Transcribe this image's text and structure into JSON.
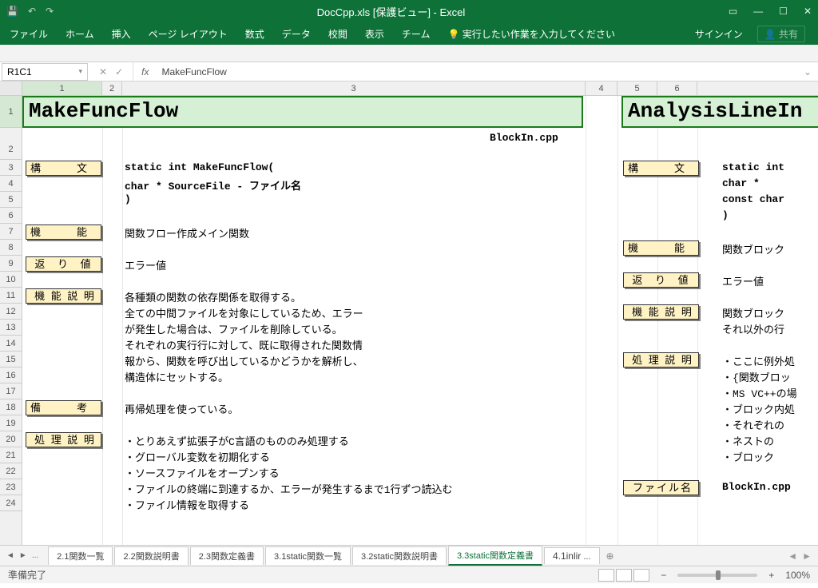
{
  "titlebar": {
    "title": "DocCpp.xls [保護ビュー] - Excel"
  },
  "ribbon": {
    "tabs": [
      "ファイル",
      "ホーム",
      "挿入",
      "ページ レイアウト",
      "数式",
      "データ",
      "校閲",
      "表示",
      "チーム"
    ],
    "tell_me": "実行したい作業を入力してください",
    "signin": "サインイン",
    "share": "共有"
  },
  "formula": {
    "name_box": "R1C1",
    "fx": "fx",
    "value": "MakeFuncFlow"
  },
  "columns": [
    "1",
    "2",
    "3",
    "4",
    "5",
    "6"
  ],
  "rows": [
    "1",
    "2",
    "3",
    "4",
    "5",
    "6",
    "7",
    "8",
    "9",
    "10",
    "11",
    "12",
    "13",
    "14",
    "15",
    "16",
    "17",
    "18",
    "19",
    "20",
    "21",
    "22",
    "23",
    "24"
  ],
  "block1": {
    "title": "MakeFuncFlow",
    "subtitle": "BlockIn.cpp",
    "labels": {
      "syntax": "構　文",
      "function": "機　能",
      "return": "返 り 値",
      "desc": "機 能 説 明",
      "note": "備　考",
      "process": "処 理 説 明"
    },
    "syntax": [
      "static int MakeFuncFlow(",
      "  char * SourceFile  - ファイル名",
      "  )"
    ],
    "function_text": "関数フロー作成メイン関数",
    "return_text": "エラー値",
    "desc_lines": [
      "各種類の関数の依存関係を取得する。",
      "全ての中間ファイルを対象にしているため、エラー",
      "が発生した場合は、ファイルを削除している。",
      "それぞれの実行行に対して、既に取得された関数情",
      "報から、関数を呼び出しているかどうかを解析し、",
      "構造体にセットする。"
    ],
    "note_text": "再帰処理を使っている。",
    "process_lines": [
      "・とりあえず拡張子がC言語のもののみ処理する",
      "・グローバル変数を初期化する",
      "・ソースファイルをオープンする",
      "・ファイルの終端に到達するか、エラーが発生するまで1行ずつ読込む",
      "  ・ファイル情報を取得する"
    ]
  },
  "block2": {
    "title": "AnalysisLineIn",
    "labels": {
      "syntax": "構　文",
      "function": "機　能",
      "return": "返 り 値",
      "desc": "機 能 説 明",
      "process": "処 理 説 明",
      "file": "ファイル名"
    },
    "syntax": [
      "static int",
      "  char *",
      "  const char",
      ")"
    ],
    "function_text": "関数ブロック",
    "return_text": "エラー値",
    "desc_lines": [
      "関数ブロック",
      "それ以外の行"
    ],
    "process_lines": [
      "・ここに例外処",
      "・{関数ブロッ",
      "・MS VC++の場",
      "・ブロック内処",
      "  ・それぞれの",
      "  ・ネストの",
      "  ・ブロック"
    ],
    "file_text": "BlockIn.cpp"
  },
  "sheet_tabs": {
    "nav": "...",
    "tabs": [
      "2.1関数一覧",
      "2.2関数説明書",
      "2.3関数定義書",
      "3.1static関数一覧",
      "3.2static関数説明書",
      "3.3static関数定義書",
      "4.1inlir"
    ],
    "active_index": 5
  },
  "status": {
    "ready": "準備完了",
    "zoom": "100%"
  }
}
